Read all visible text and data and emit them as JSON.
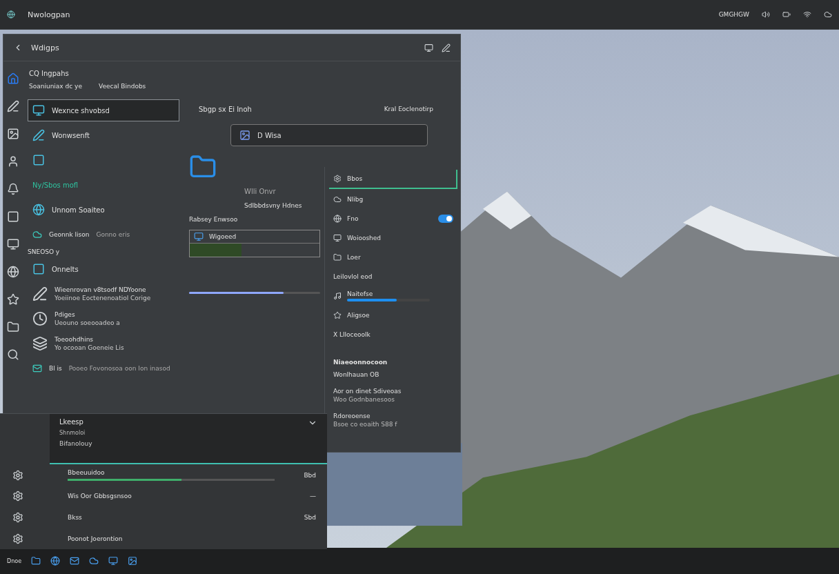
{
  "top_bar": {
    "title": "Nwologpan",
    "status_text": "GMGHGW"
  },
  "window": {
    "title": "Wdigps"
  },
  "account": {
    "name": "CQ Ingpahs",
    "detail": "Soaniuniax dc ye",
    "link": "Veecal Bindobs"
  },
  "left_list": [
    {
      "kind": "row",
      "label": "Wexnce shvobsd",
      "selected": true
    },
    {
      "kind": "row",
      "label": "Wonwsenft",
      "selected": false
    },
    {
      "kind": "row",
      "selected": false
    },
    {
      "kind": "accent",
      "label": "Ny/Sbos mofl",
      "selected": false
    },
    {
      "kind": "row",
      "label": "Unnom Soaiteo",
      "selected": false
    },
    {
      "kind": "pair",
      "label": "Geonnk lison",
      "detail": "Gonno eris",
      "selected": false
    },
    {
      "kind": "section",
      "label": "SNEOSO y"
    },
    {
      "kind": "row",
      "label": "Onnelts",
      "selected": false
    },
    {
      "kind": "two_line",
      "label": "Wieenrovan v8tsodf NDYoone",
      "detail": "Yoeiinoe Eoctenenoatiol Corige",
      "selected": false
    },
    {
      "kind": "two_line",
      "label": "Pdiges",
      "detail": "Ueouno soeooadeo a",
      "selected": false
    },
    {
      "kind": "two_line",
      "label": "Toeoohdhins",
      "detail": "Yo ocooan Goeneie Lis",
      "selected": false
    },
    {
      "kind": "pair",
      "label": "Bl is",
      "detail": "Pooeo Fovonosoa oon Ion inasod",
      "selected": false
    }
  ],
  "middle": {
    "title": "Sbgp sx Ei Inoh",
    "action": "Kral Eoclenotirp",
    "field_value": "D Wisa",
    "line_1": "Wlli Onvr",
    "line_2": "Sdlbbdsvny Hdnes",
    "caption": "Rabsey Enwsoo",
    "card_label": "Wigoeed",
    "slider": {
      "level": 0.72
    }
  },
  "right_list": [
    {
      "kind": "row",
      "label": "Bbos",
      "selected": true
    },
    {
      "kind": "row",
      "label": "Nlibg",
      "selected": false
    },
    {
      "kind": "toggle",
      "label": "Fno",
      "on": true,
      "selected": false
    },
    {
      "kind": "row",
      "label": "Woiooshed",
      "selected": false
    },
    {
      "kind": "row",
      "label": "Loer",
      "selected": false
    },
    {
      "kind": "plain",
      "label": "Leilovlol eod",
      "selected": false
    },
    {
      "kind": "progress",
      "label": "Naitefse",
      "level": 0.6,
      "selected": false
    },
    {
      "kind": "row",
      "label": "Aligsoe",
      "selected": false
    },
    {
      "kind": "plain",
      "label": "X Llloceoolk",
      "selected": false
    }
  ],
  "right_section": {
    "title": "Niaeoonnocoon",
    "items": [
      {
        "label": "Wonlhauan OB"
      },
      {
        "label": "Aor on dinet Sdiveoas",
        "detail": "Woo Godnbanesoos"
      },
      {
        "label": "Rdoreoense",
        "detail": "Bsoe co eoaith S88 f"
      }
    ]
  },
  "bottom_panel": {
    "dropdown": {
      "title": "Lkeesp",
      "line_1": "Shnmoloi",
      "line_2": "Bifanolouy",
      "expanded": true
    },
    "rows": [
      {
        "label": "Bbeeuuidoo",
        "value": "Bbd",
        "level": 0.55
      },
      {
        "label": "Wis Oor Gbbsgsnsoo",
        "value": "—"
      },
      {
        "label": "Bkss",
        "value": "Sbd"
      },
      {
        "label": "Poonot Joerontion"
      }
    ]
  },
  "taskbar": {
    "label": "Dnoe"
  }
}
